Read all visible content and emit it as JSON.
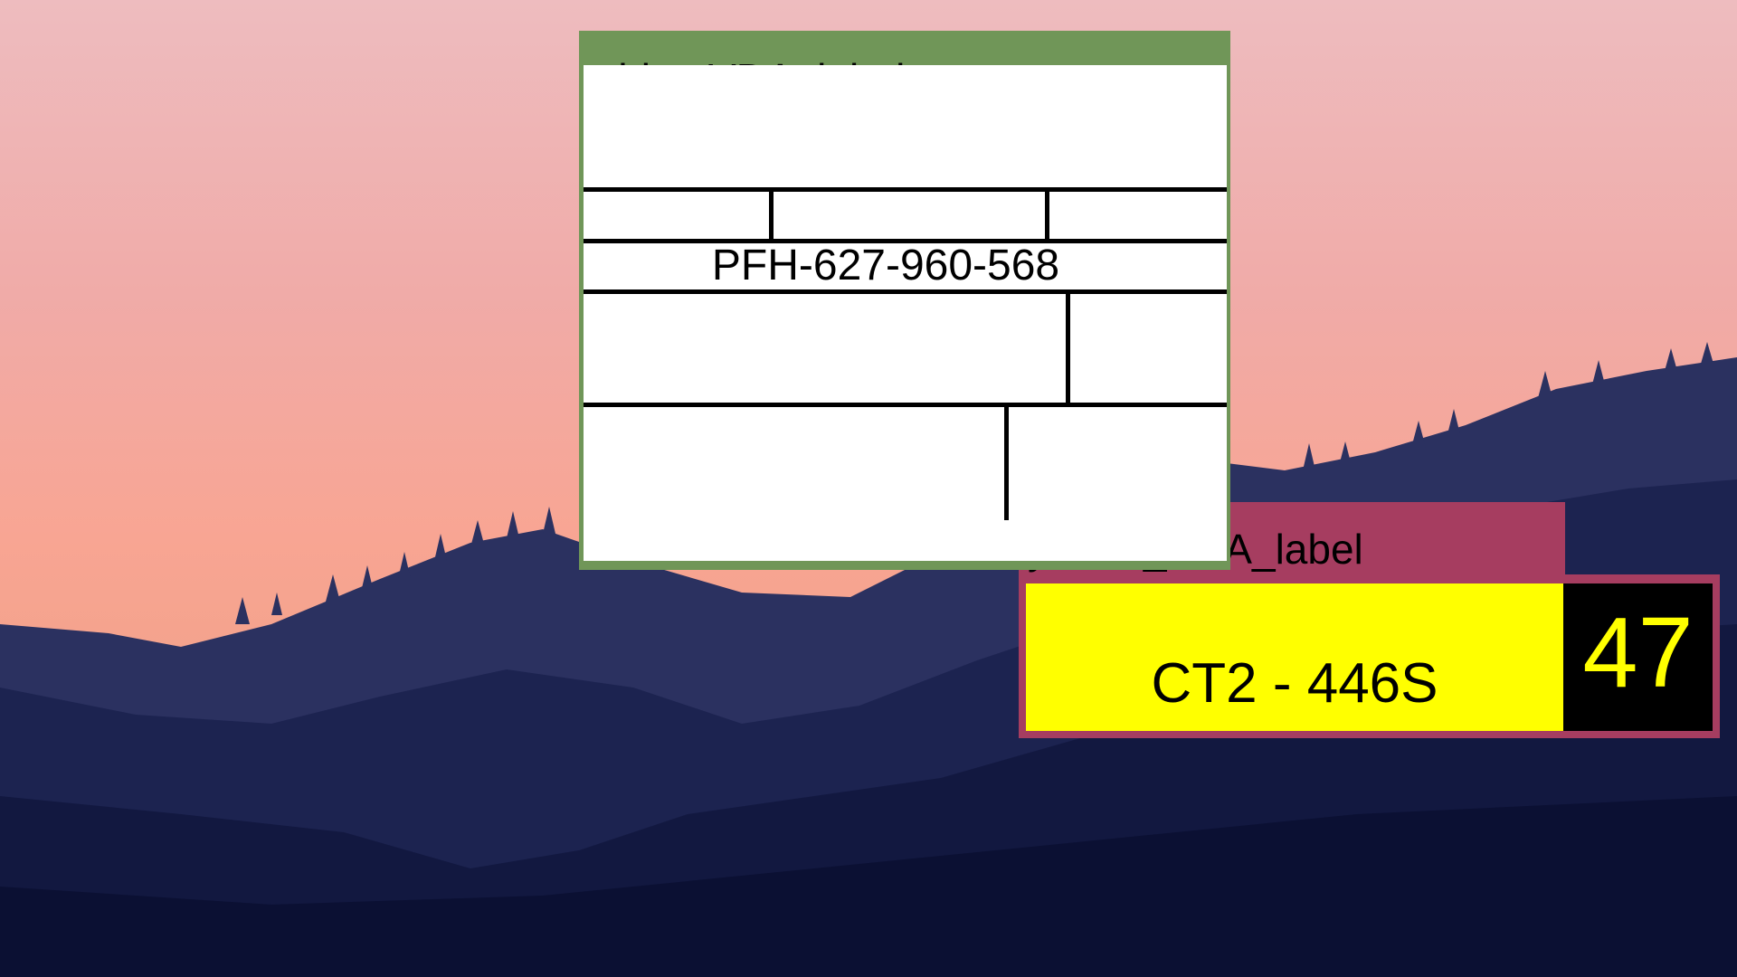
{
  "windows": {
    "white_label": {
      "title": "white_VDA_label",
      "part_number": "PFH-627-960-568",
      "title_color": "#709658"
    },
    "yellow_label": {
      "title": "yellow_VDA_label",
      "code": "CT2 - 446S",
      "number": "47",
      "title_color": "#a63d60",
      "panel_color": "#ffff00"
    }
  }
}
